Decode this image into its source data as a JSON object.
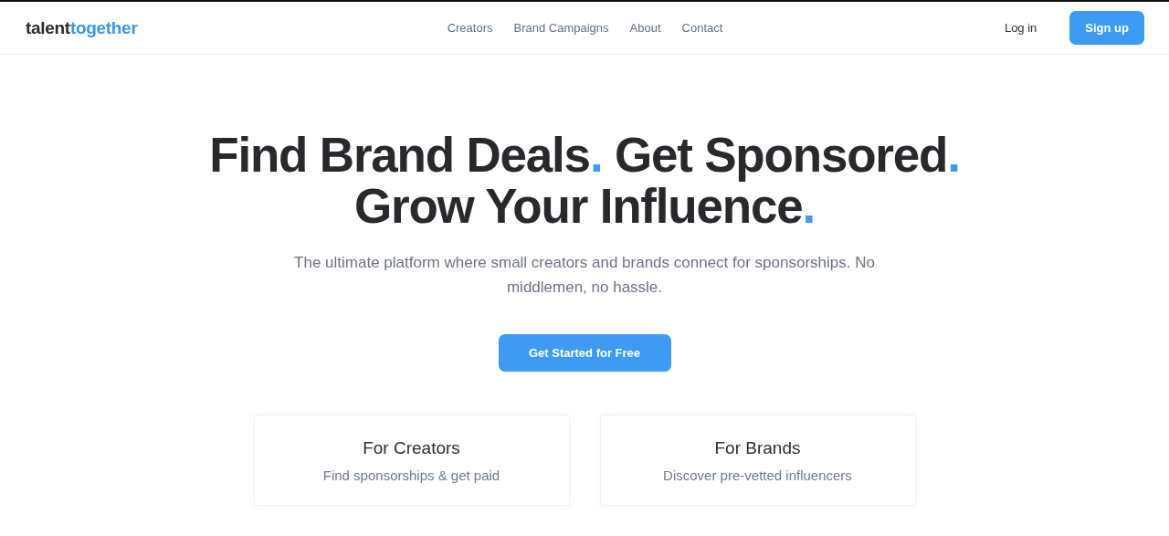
{
  "logo": {
    "first": "talent",
    "second": "together"
  },
  "nav": [
    "Creators",
    "Brand Campaigns",
    "About",
    "Contact"
  ],
  "auth": {
    "login": "Log in",
    "signup": "Sign up"
  },
  "headline": [
    [
      {
        "text": "Find Brand Deals",
        "end": "."
      },
      {
        "text": " Get Sponsored",
        "end": "."
      }
    ],
    [
      {
        "text": "Grow Your Influence",
        "end": "."
      }
    ]
  ],
  "subtitle": "The ultimate platform where small creators and brands connect for sponsorships. No middlemen, no hassle.",
  "cta": "Get Started for Free",
  "cards": [
    {
      "title": "For Creators",
      "text": "Find sponsorships & get paid"
    },
    {
      "title": "For Brands",
      "text": "Discover pre-vetted influencers"
    }
  ]
}
